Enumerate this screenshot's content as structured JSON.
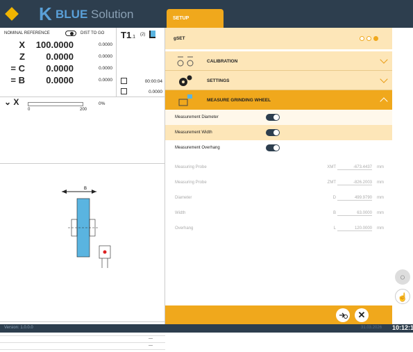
{
  "app": {
    "brand_blue": "BLUE",
    "brand_rest": " Solution",
    "accent": "#f0a81c",
    "dark": "#2d3e4e"
  },
  "tabs": [
    {
      "label": "SETUP"
    }
  ],
  "dro": {
    "header_left": "NOMINAL REFERENCE",
    "header_right": "DIST TO GO",
    "axes": [
      {
        "name": "X",
        "value": "100.0000",
        "dtg": "0.0000"
      },
      {
        "name": "Z",
        "value": "0.0000",
        "dtg": "0.0000"
      },
      {
        "name": "= C",
        "value": "0.0000",
        "dtg": "0.0000"
      },
      {
        "name": "= B",
        "value": "0.0000",
        "dtg": "0.0000"
      }
    ]
  },
  "tool": {
    "label": "T1",
    "sub": ".1",
    "num": "(2)",
    "time": "00:00:04",
    "feed": "0.0000"
  },
  "progress": {
    "axis": "X",
    "min": "0",
    "max": "200",
    "percent": "0%",
    "fraction": 0.0
  },
  "drawing": {
    "dim_label": "B"
  },
  "messages": [
    "----",
    "---",
    "---",
    "---"
  ],
  "setup": {
    "gset": "gSET",
    "sections": [
      {
        "title": "CALIBRATION",
        "icon": "calibration-icon"
      },
      {
        "title": "SETTINGS",
        "icon": "settings-gears-icon"
      },
      {
        "title": "MEASURE GRINDING WHEEL",
        "icon": "measure-wheel-icon"
      }
    ],
    "toggles": [
      {
        "label": "Measurement Diameter",
        "on": true
      },
      {
        "label": "Measurement Width",
        "on": true
      },
      {
        "label": "Measurement Overhang",
        "on": true
      }
    ],
    "measures": [
      {
        "label": "Measuring Probe",
        "axis": "XMT",
        "value": "-673.4437",
        "unit": "mm"
      },
      {
        "label": "Measuring Probe",
        "axis": "ZMT",
        "value": "-826.2003",
        "unit": "mm"
      },
      {
        "label": "Diameter",
        "axis": "D",
        "value": "499.9790",
        "unit": "mm"
      },
      {
        "label": "Width",
        "axis": "B",
        "value": "63.0000",
        "unit": "mm"
      },
      {
        "label": "Overhang",
        "axis": "L",
        "value": "120.0000",
        "unit": "mm"
      }
    ]
  },
  "status": {
    "version": "Version: 1.0.0.0",
    "date": "31.03.2026",
    "time": "10:12:16"
  }
}
